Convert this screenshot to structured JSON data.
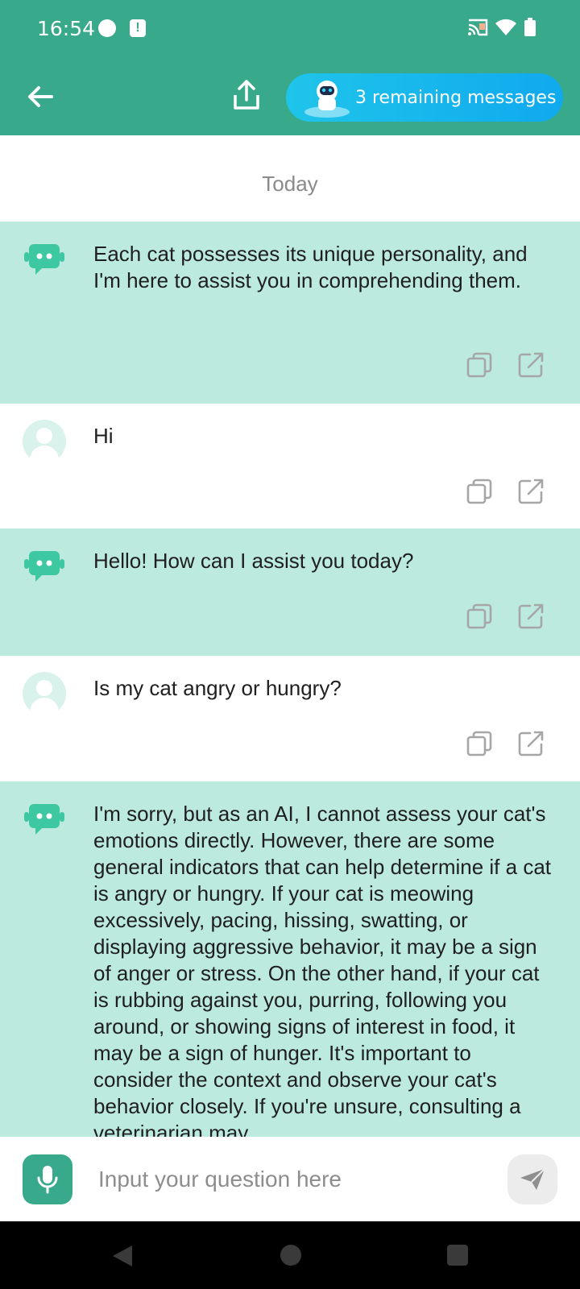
{
  "status_bar": {
    "time": "16:54"
  },
  "header": {
    "remaining_label": "3 remaining messages"
  },
  "date_separator": "Today",
  "messages": [
    {
      "role": "bot",
      "text": "Each cat possesses its unique personality, and I'm here to assist you in comprehending them."
    },
    {
      "role": "user",
      "text": "Hi"
    },
    {
      "role": "bot",
      "text": "Hello! How can I assist you today?"
    },
    {
      "role": "user",
      "text": "Is my cat angry or hungry?"
    },
    {
      "role": "bot",
      "text": "I'm sorry, but as an AI, I cannot assess your cat's emotions directly. However, there are some general indicators that can help determine if a cat is angry or hungry. If your cat is meowing excessively, pacing, hissing, swatting, or displaying aggressive behavior, it may be a sign of anger or stress. On the other hand, if your cat is rubbing against you, purring, following you around, or showing signs of interest in food, it may be a sign of hunger. It's important to consider the context and observe your cat's behavior closely. If you're unsure, consulting a veterinarian may"
    }
  ],
  "input": {
    "placeholder": "Input your question here",
    "value": ""
  },
  "colors": {
    "primary": "#38a98b",
    "bot_bubble": "#bceade",
    "pill": "#1fc4ea"
  },
  "icons": [
    "back-arrow-icon",
    "share-icon",
    "robot-icon",
    "copy-icon",
    "edit-icon",
    "mic-icon",
    "send-icon"
  ]
}
